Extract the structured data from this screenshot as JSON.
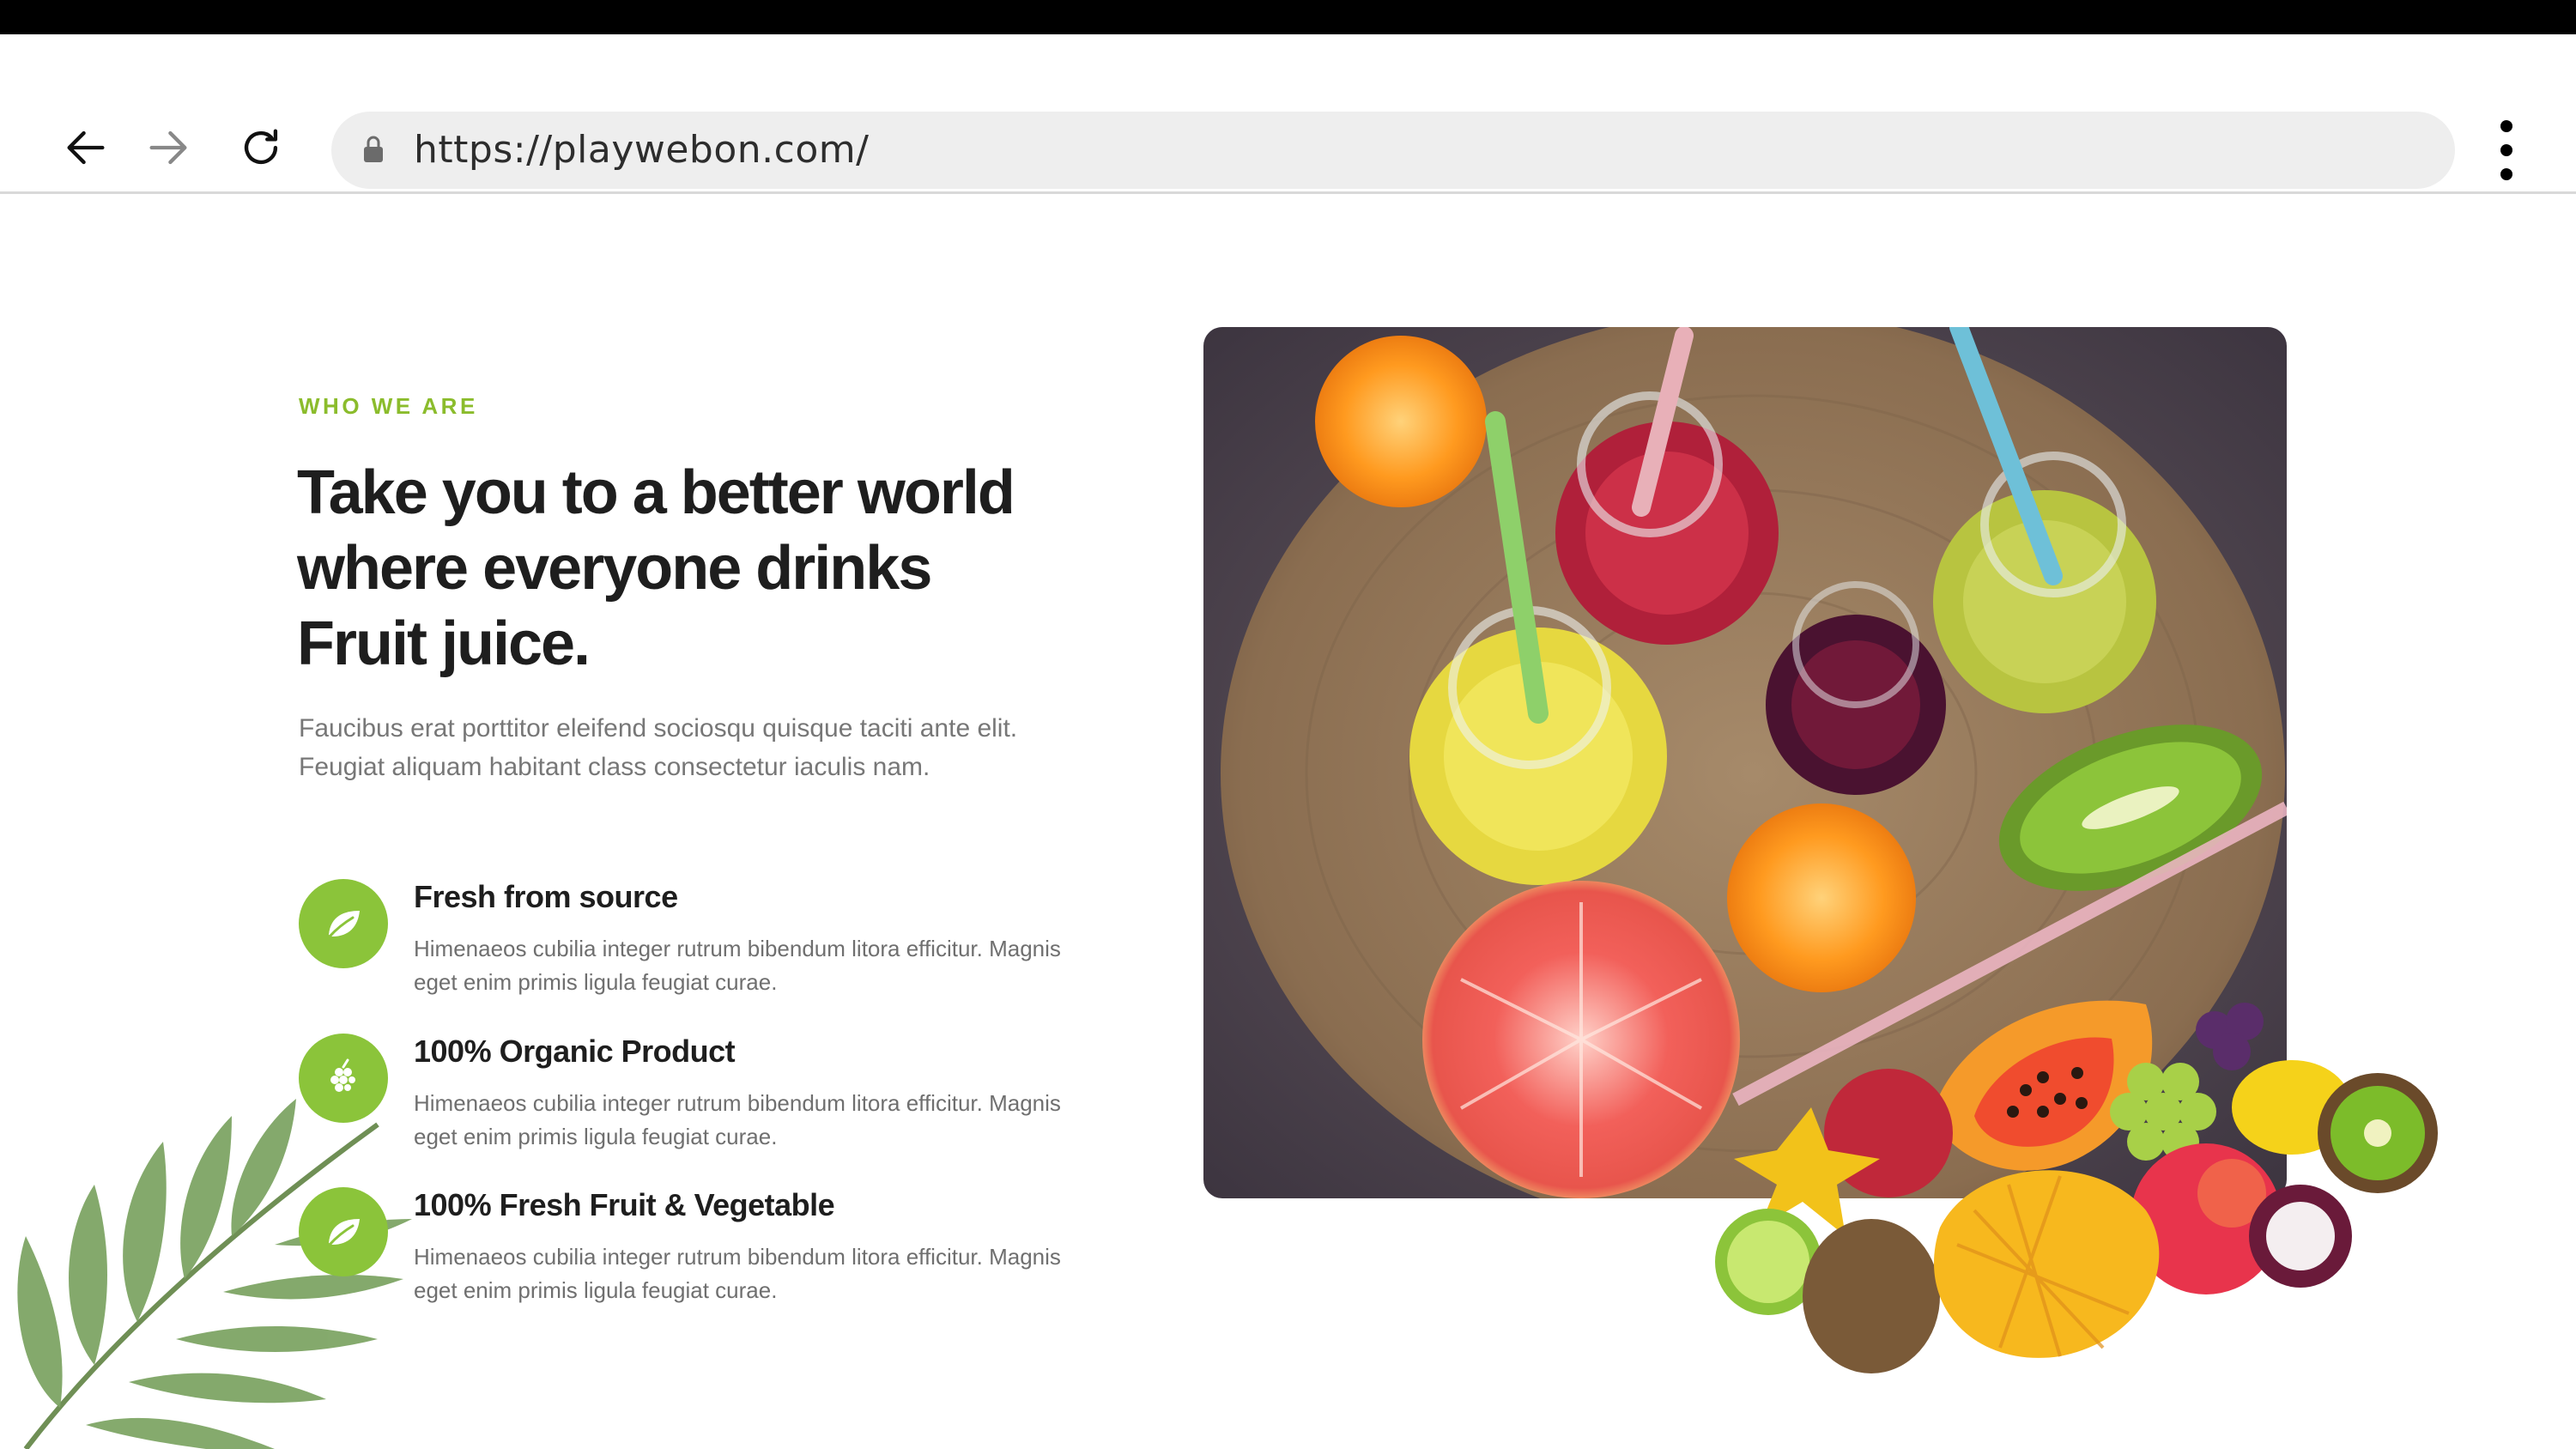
{
  "browser": {
    "url": "https://playwebon.com/",
    "icons": [
      "back-arrow-icon",
      "forward-arrow-icon",
      "reload-icon",
      "lock-icon",
      "more-vert-icon"
    ]
  },
  "section": {
    "eyebrow": "WHO WE ARE",
    "heading": "Take you to a better world where everyone drinks Fruit juice.",
    "lead": "Faucibus erat porttitor eleifend sociosqu quisque taciti ante elit. Feugiat aliquam habitant class consectetur iaculis nam.",
    "features": [
      {
        "title": "Fresh from source",
        "desc": "Himenaeos cubilia integer rutrum bibendum litora efficitur. Magnis eget enim primis ligula feugiat curae.",
        "icon": "leaf-icon"
      },
      {
        "title": "100% Organic Product",
        "desc": "Himenaeos cubilia integer rutrum bibendum litora efficitur. Magnis eget enim primis ligula feugiat curae.",
        "icon": "grapes-icon"
      },
      {
        "title": "100% Fresh Fruit & Vegetable",
        "desc": "Himenaeos cubilia integer rutrum bibendum litora efficitur. Magnis eget enim primis ligula feugiat curae.",
        "icon": "leaf-icon"
      }
    ]
  },
  "colors": {
    "accent": "#8bc43a",
    "eyebrow": "#8bbc2c",
    "heading": "#1e1e1e",
    "body_text": "#777777"
  }
}
